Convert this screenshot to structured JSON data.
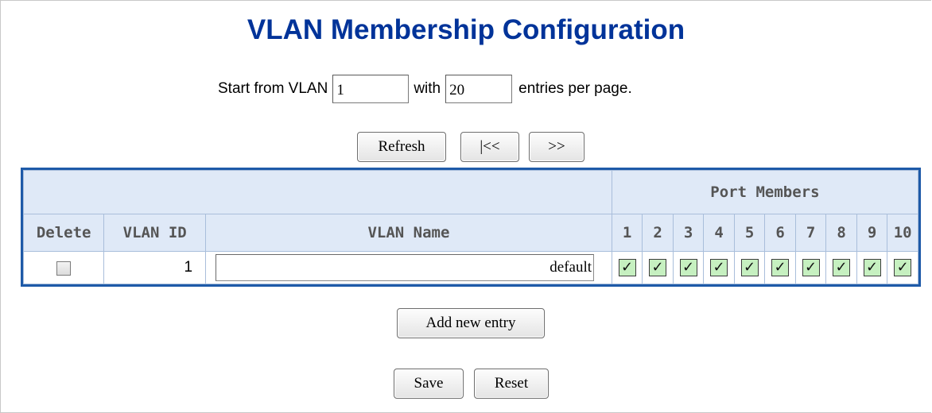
{
  "page": {
    "title": "VLAN Membership Configuration"
  },
  "paging": {
    "start_label": "Start from VLAN",
    "start_value": "1",
    "with_label": "with",
    "entries_value": "20",
    "entries_label": "entries per page."
  },
  "buttons": {
    "refresh": "Refresh",
    "prev": "|<<",
    "next": ">>",
    "add": "Add new entry",
    "save": "Save",
    "reset": "Reset"
  },
  "table": {
    "group_header": "Port Members",
    "headers": {
      "delete": "Delete",
      "vlan_id": "VLAN ID",
      "vlan_name": "VLAN Name"
    },
    "ports": [
      "1",
      "2",
      "3",
      "4",
      "5",
      "6",
      "7",
      "8",
      "9",
      "10"
    ],
    "rows": [
      {
        "delete_checked": false,
        "vlan_id": "1",
        "vlan_name": "default",
        "members": [
          true,
          true,
          true,
          true,
          true,
          true,
          true,
          true,
          true,
          true
        ]
      }
    ]
  },
  "colors": {
    "title": "#003399",
    "header_bg": "#dfe9f7",
    "table_border": "#1e5aa8",
    "member_checked_bg": "#c6f0c0"
  },
  "icons": {
    "member_check": "checkmark-icon"
  }
}
